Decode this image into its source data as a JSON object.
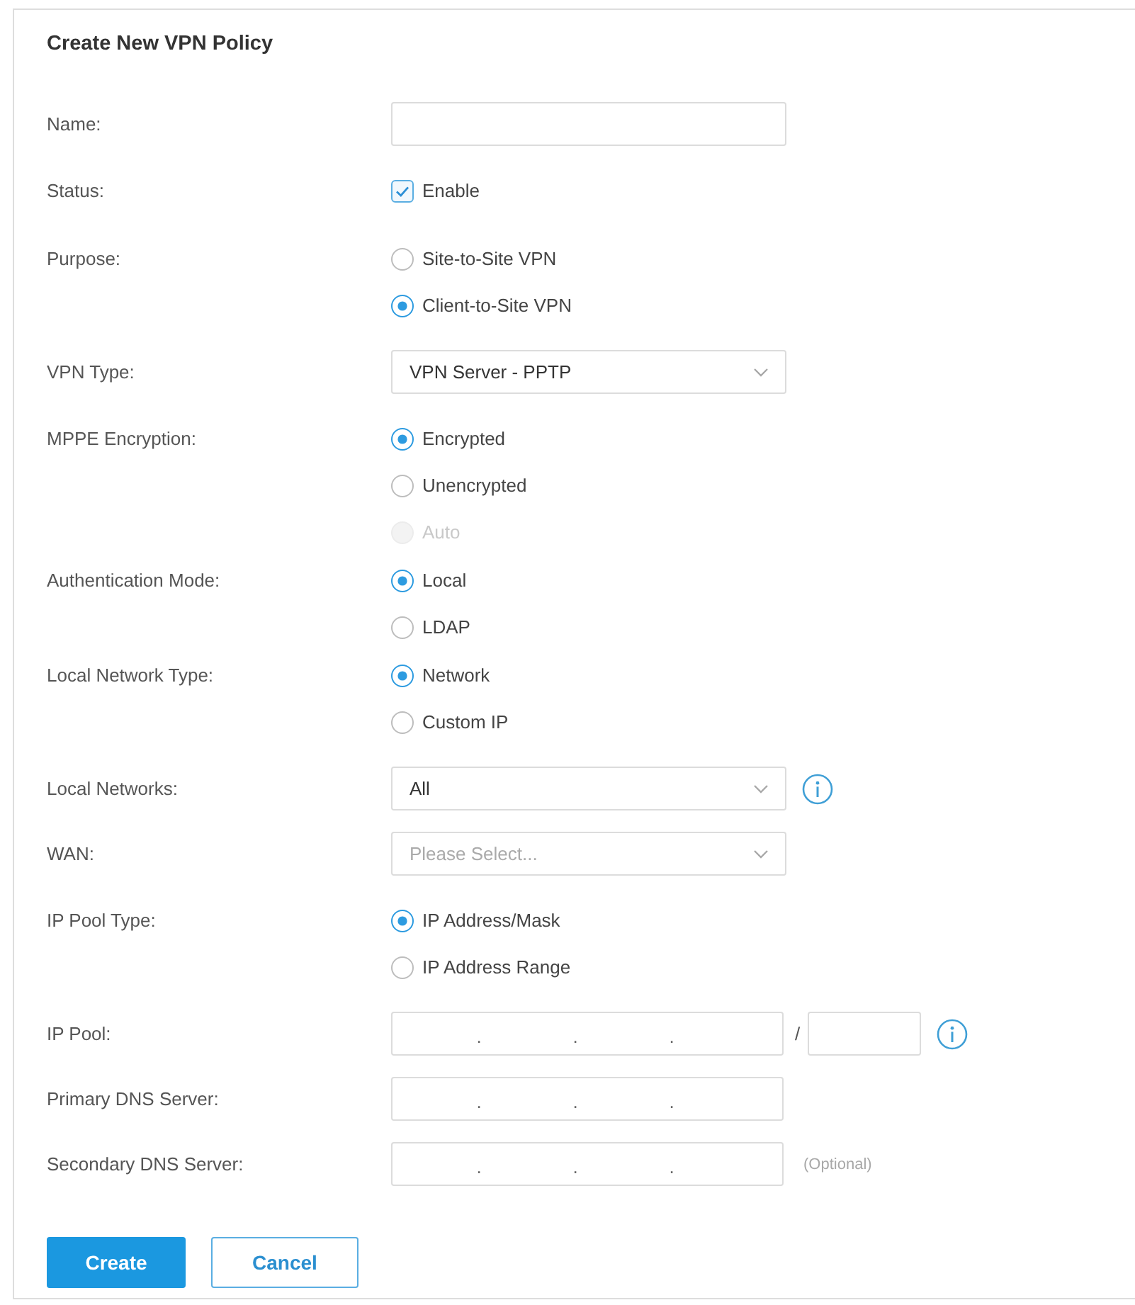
{
  "title": "Create New VPN Policy",
  "fields": [
    {
      "label": "Name:",
      "kind": "text"
    },
    {
      "label": "Status:",
      "kind": "checkbox",
      "option": "Enable",
      "checked": true
    },
    {
      "label": "Purpose:",
      "kind": "radio",
      "options": [
        {
          "label": "Site-to-Site VPN",
          "selected": false,
          "disabled": false
        },
        {
          "label": "Client-to-Site VPN",
          "selected": true,
          "disabled": false
        }
      ]
    },
    {
      "label": "VPN Type:",
      "kind": "select",
      "value": "VPN Server - PPTP"
    },
    {
      "label": "MPPE Encryption:",
      "kind": "radio",
      "options": [
        {
          "label": "Encrypted",
          "selected": true,
          "disabled": false
        },
        {
          "label": "Unencrypted",
          "selected": false,
          "disabled": false
        },
        {
          "label": "Auto",
          "selected": false,
          "disabled": true
        }
      ]
    },
    {
      "label": "Authentication Mode:",
      "kind": "radio",
      "options": [
        {
          "label": "Local",
          "selected": true,
          "disabled": false
        },
        {
          "label": "LDAP",
          "selected": false,
          "disabled": false
        }
      ]
    },
    {
      "label": "Local Network Type:",
      "kind": "radio",
      "options": [
        {
          "label": "Network",
          "selected": true,
          "disabled": false
        },
        {
          "label": "Custom IP",
          "selected": false,
          "disabled": false
        }
      ]
    },
    {
      "label": "Local Networks:",
      "kind": "select",
      "value": "All",
      "info": true
    },
    {
      "label": "WAN:",
      "kind": "select",
      "placeholder": "Please Select..."
    },
    {
      "label": "IP Pool Type:",
      "kind": "radio",
      "options": [
        {
          "label": "IP Address/Mask",
          "selected": true,
          "disabled": false
        },
        {
          "label": "IP Address Range",
          "selected": false,
          "disabled": false
        }
      ]
    },
    {
      "label": "IP Pool:",
      "kind": "ip_mask",
      "separators": [
        ".",
        ".",
        "."
      ],
      "mask_separator": "/",
      "info": true
    },
    {
      "label": "Primary DNS Server:",
      "kind": "ip",
      "separators": [
        ".",
        ".",
        "."
      ]
    },
    {
      "label": "Secondary DNS Server:",
      "kind": "ip",
      "separators": [
        ".",
        ".",
        "."
      ],
      "note": "(Optional)"
    }
  ],
  "buttons": [
    {
      "label": "Create",
      "kind": "primary"
    },
    {
      "label": "Cancel",
      "kind": "secondary"
    }
  ]
}
